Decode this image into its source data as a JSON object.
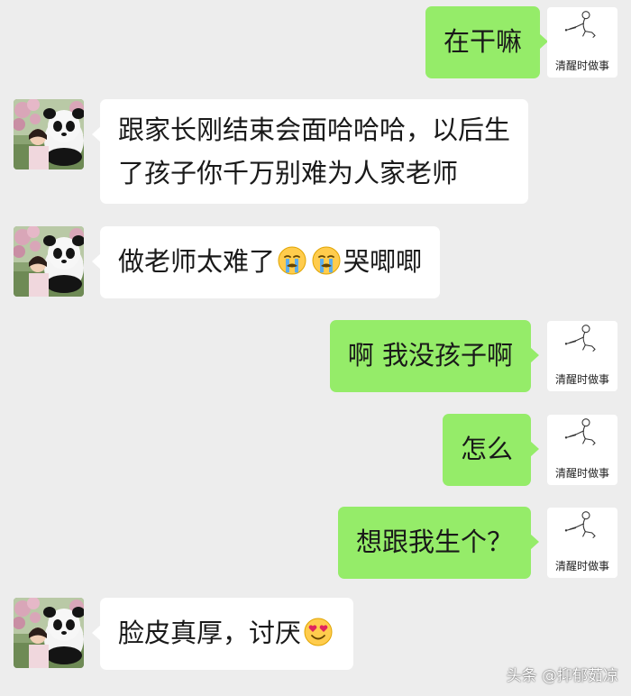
{
  "messages": [
    {
      "sender": "self",
      "text": "在干嘛"
    },
    {
      "sender": "other",
      "line1": "跟家长刚结束会面哈哈哈，以后生",
      "line2": "了孩子你千万别难为人家老师"
    },
    {
      "sender": "other",
      "before": "做老师太难了",
      "emoji1": "loudly-crying-face",
      "emoji2": "loudly-crying-face",
      "after": "哭唧唧"
    },
    {
      "sender": "self",
      "text": "啊 我没孩子啊"
    },
    {
      "sender": "self",
      "text": "怎么"
    },
    {
      "sender": "self",
      "text": "想跟我生个？"
    },
    {
      "sender": "other",
      "before": "脸皮真厚，讨厌",
      "emoji1": "smiling-face-with-heart-eyes"
    }
  ],
  "self_avatar_caption": "清醒时做事",
  "watermark": "头条 @抑郁茹凉",
  "colors": {
    "background": "#ededed",
    "self_bubble": "#95ec69",
    "other_bubble": "#ffffff",
    "text": "#191919"
  }
}
